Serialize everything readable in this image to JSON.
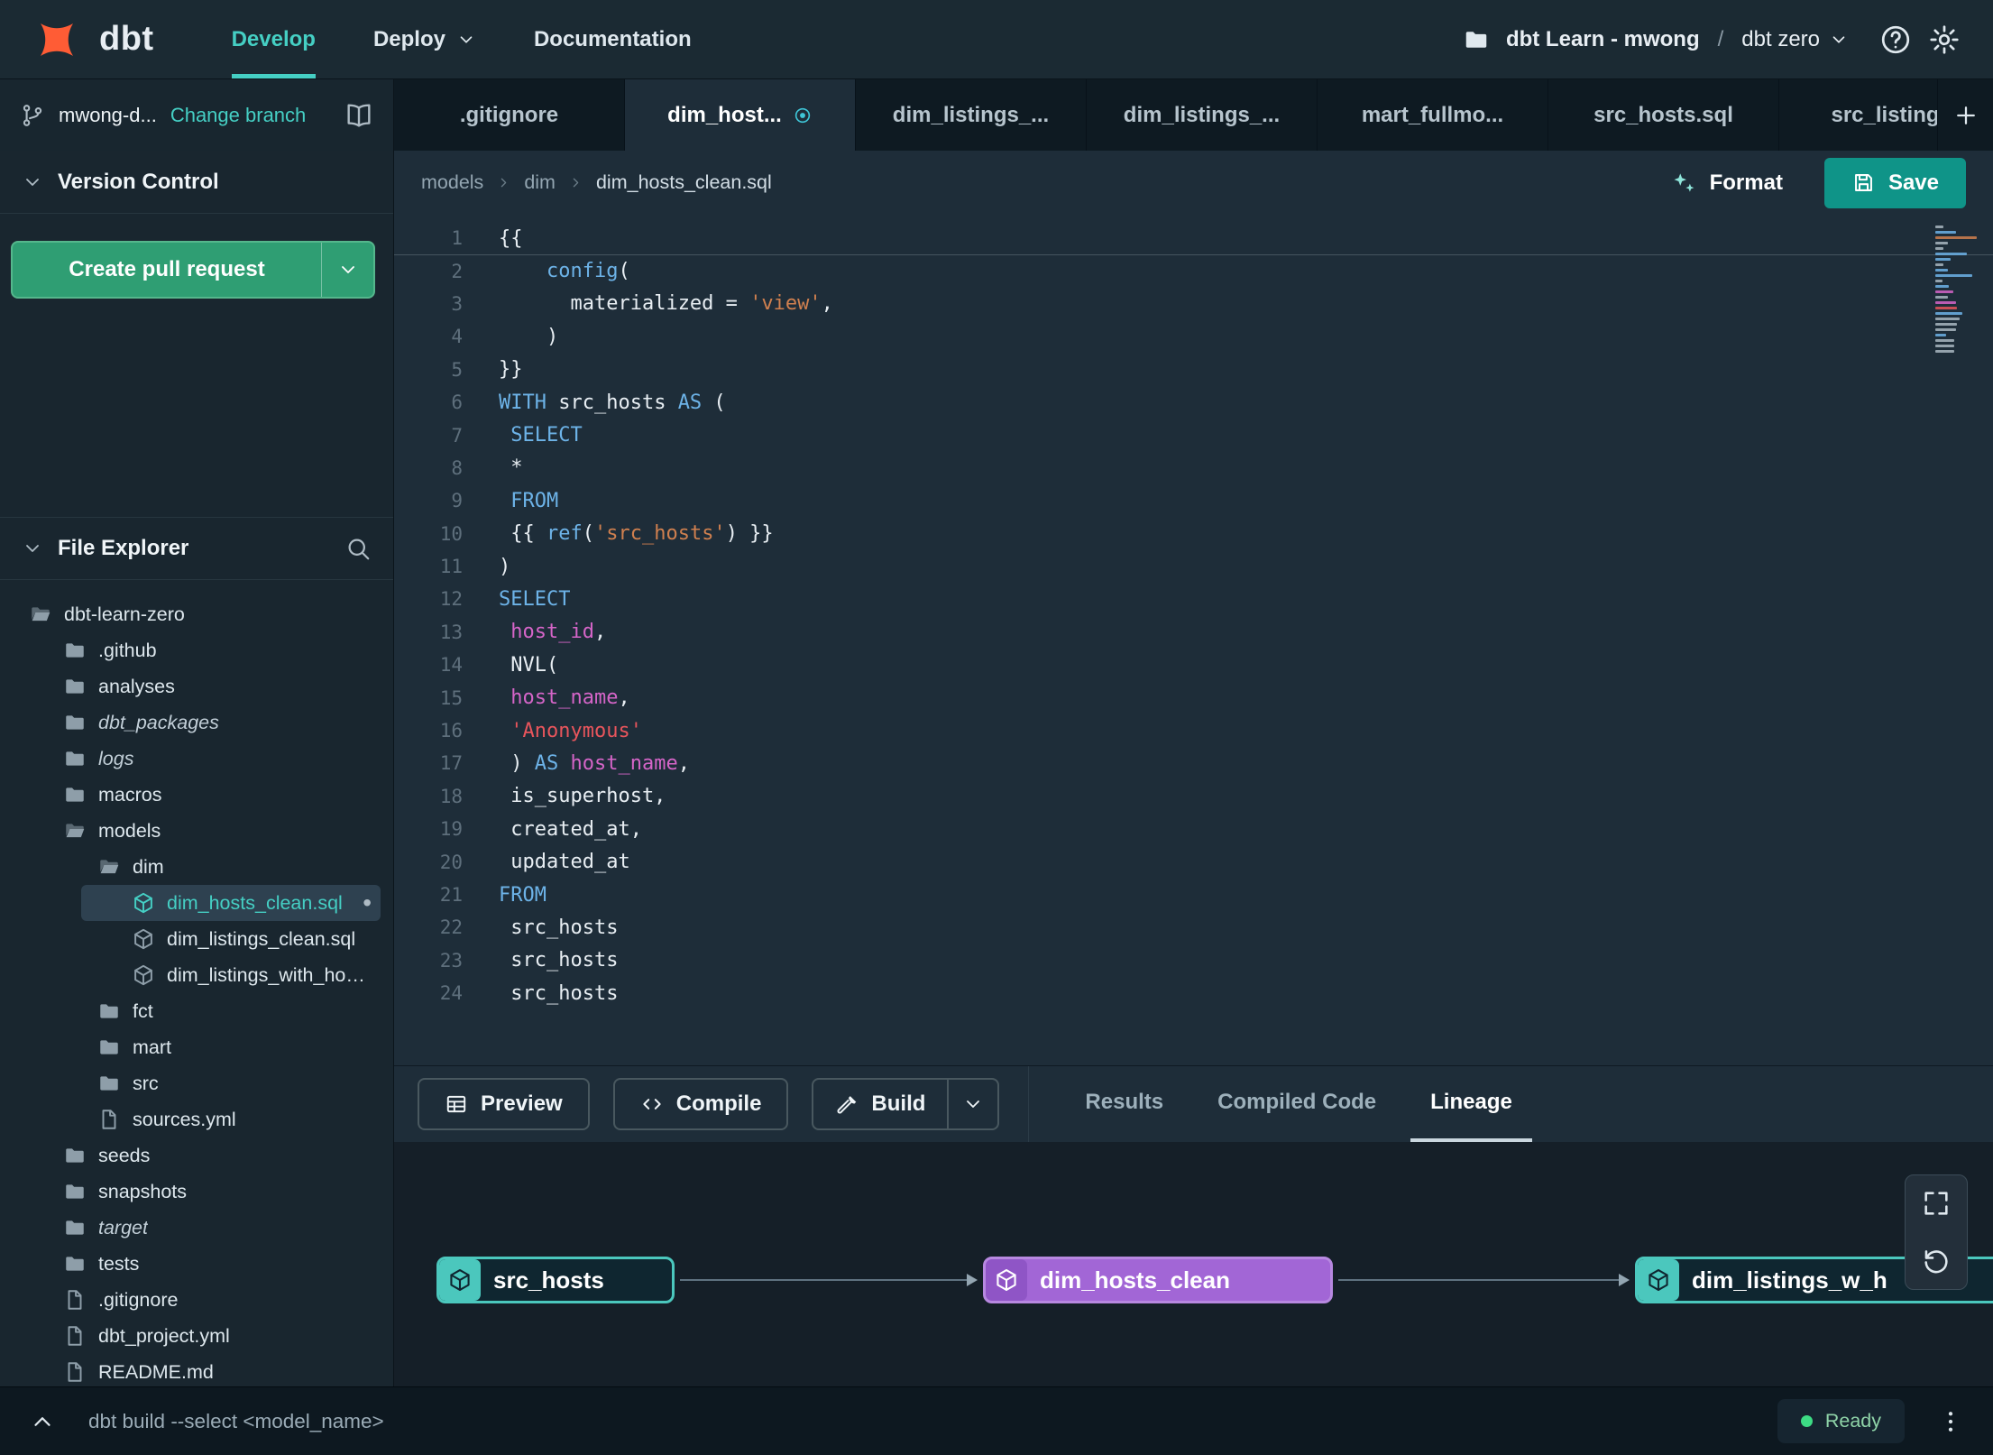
{
  "theme": {
    "accent-teal": "#45cfc4",
    "accent-green": "#2f9e73",
    "save-green": "#0f9488",
    "brand-orange": "#ff5c35",
    "node-teal": "#4bc7bd",
    "node-purple": "#a266d6",
    "code-keyword": "#6db3e8",
    "code-variable": "#d565c8",
    "code-string": "#d0804f",
    "code-string-alt": "#e8555c",
    "status-green": "#3ddc84"
  },
  "navbar": {
    "brand": "dbt",
    "items": [
      {
        "label": "Develop",
        "active": true
      },
      {
        "label": "Deploy",
        "caret": true
      },
      {
        "label": "Documentation"
      }
    ],
    "project": "dbt Learn - mwong",
    "separator": "/",
    "environment": "dbt zero",
    "right_icons": [
      "folder-icon",
      "chevron-down-icon",
      "help-icon",
      "gear-icon"
    ]
  },
  "branch_bar": {
    "branch": "mwong-d...",
    "change_branch": "Change branch",
    "icons": [
      "git-branch-icon",
      "book-icon"
    ]
  },
  "tabs": [
    {
      "label": ".gitignore"
    },
    {
      "label": "dim_host...",
      "active": true,
      "modified": true,
      "modified_icon": "circle-dot"
    },
    {
      "label": "dim_listings_..."
    },
    {
      "label": "dim_listings_..."
    },
    {
      "label": "mart_fullmo..."
    },
    {
      "label": "src_hosts.sql"
    },
    {
      "label": "src_listings."
    }
  ],
  "sidebar": {
    "version_control": {
      "title": "Version Control",
      "create_pr": "Create pull request"
    },
    "file_explorer": {
      "title": "File Explorer",
      "icon": "search-icon"
    },
    "tree": [
      {
        "label": "dbt-learn-zero",
        "type": "folder-open",
        "depth": 0
      },
      {
        "label": ".github",
        "type": "folder",
        "depth": 1
      },
      {
        "label": "analyses",
        "type": "folder",
        "depth": 1
      },
      {
        "label": "dbt_packages",
        "type": "folder",
        "depth": 1,
        "italic": true
      },
      {
        "label": "logs",
        "type": "folder",
        "depth": 1,
        "italic": true
      },
      {
        "label": "macros",
        "type": "folder",
        "depth": 1
      },
      {
        "label": "models",
        "type": "folder-open",
        "depth": 1
      },
      {
        "label": "dim",
        "type": "folder-open",
        "depth": 2
      },
      {
        "label": "dim_hosts_clean.sql",
        "type": "model",
        "depth": 3,
        "selected": true,
        "modified": true
      },
      {
        "label": "dim_listings_clean.sql",
        "type": "model",
        "depth": 3
      },
      {
        "label": "dim_listings_with_hosts...",
        "type": "model",
        "depth": 3
      },
      {
        "label": "fct",
        "type": "folder",
        "depth": 2
      },
      {
        "label": "mart",
        "type": "folder",
        "depth": 2
      },
      {
        "label": "src",
        "type": "folder",
        "depth": 2
      },
      {
        "label": "sources.yml",
        "type": "file",
        "depth": 2
      },
      {
        "label": "seeds",
        "type": "folder",
        "depth": 1
      },
      {
        "label": "snapshots",
        "type": "folder",
        "depth": 1
      },
      {
        "label": "target",
        "type": "folder",
        "depth": 1,
        "italic": true
      },
      {
        "label": "tests",
        "type": "folder",
        "depth": 1
      },
      {
        "label": ".gitignore",
        "type": "file",
        "depth": 1
      },
      {
        "label": "dbt_project.yml",
        "type": "file",
        "depth": 1
      },
      {
        "label": "README.md",
        "type": "file",
        "depth": 1
      }
    ]
  },
  "editor": {
    "breadcrumb": [
      "models",
      "dim",
      "dim_hosts_clean.sql"
    ],
    "format_label": "Format",
    "save_label": "Save",
    "code": [
      [
        [
          "{{",
          "p"
        ]
      ],
      [
        [
          "    ",
          "p"
        ],
        [
          "config",
          "fn"
        ],
        [
          "(",
          "p"
        ]
      ],
      [
        [
          "      ",
          "p"
        ],
        [
          "materialized",
          "p"
        ],
        [
          " = ",
          "p"
        ],
        [
          "'view'",
          "str"
        ],
        [
          ",",
          "p"
        ]
      ],
      [
        [
          "    )",
          "p"
        ]
      ],
      [
        [
          "}}",
          "p"
        ]
      ],
      [
        [
          "WITH",
          "kw"
        ],
        [
          " src_hosts ",
          "p"
        ],
        [
          "AS",
          "kw"
        ],
        [
          " (",
          "p"
        ]
      ],
      [
        [
          " ",
          "p"
        ],
        [
          "SELECT",
          "kw"
        ]
      ],
      [
        [
          " *",
          "p"
        ]
      ],
      [
        [
          " ",
          "p"
        ],
        [
          "FROM",
          "kw"
        ]
      ],
      [
        [
          " {{ ",
          "p"
        ],
        [
          "ref",
          "fn"
        ],
        [
          "(",
          "p"
        ],
        [
          "'src_hosts'",
          "str"
        ],
        [
          ") }}",
          "p"
        ]
      ],
      [
        [
          ")",
          "p"
        ]
      ],
      [
        [
          "SELECT",
          "kw"
        ]
      ],
      [
        [
          " ",
          "p"
        ],
        [
          "host_id",
          "var"
        ],
        [
          ",",
          "p"
        ]
      ],
      [
        [
          " NVL(",
          "p"
        ]
      ],
      [
        [
          " ",
          "p"
        ],
        [
          "host_name",
          "var"
        ],
        [
          ",",
          "p"
        ]
      ],
      [
        [
          " ",
          "p"
        ],
        [
          "'Anonymous'",
          "str2"
        ]
      ],
      [
        [
          " ) ",
          "p"
        ],
        [
          "AS",
          "kw"
        ],
        [
          " ",
          "p"
        ],
        [
          "host_name",
          "var"
        ],
        [
          ",",
          "p"
        ]
      ],
      [
        [
          " is_superhost,",
          "p"
        ]
      ],
      [
        [
          " created_at,",
          "p"
        ]
      ],
      [
        [
          " updated_at",
          "p"
        ]
      ],
      [
        [
          "FROM",
          "kw"
        ]
      ],
      [
        [
          " src_hosts",
          "p"
        ]
      ],
      [
        [
          " src_hosts",
          "p"
        ]
      ],
      [
        [
          " src_hosts",
          "p"
        ]
      ]
    ]
  },
  "bottom": {
    "actions": [
      {
        "label": "Preview",
        "icon": "table"
      },
      {
        "label": "Compile",
        "icon": "code"
      },
      {
        "label": "Build",
        "icon": "hammer",
        "split": true
      }
    ],
    "tabs": [
      {
        "label": "Results"
      },
      {
        "label": "Compiled Code"
      },
      {
        "label": "Lineage",
        "active": true
      }
    ],
    "lineage": {
      "nodes": [
        {
          "label": "src_hosts",
          "kind": "teal"
        },
        {
          "label": "dim_hosts_clean",
          "kind": "purple"
        },
        {
          "label": "dim_listings_w_h",
          "kind": "teal"
        }
      ],
      "controls": [
        "expand-icon",
        "rotate-ccw-icon"
      ]
    }
  },
  "status_bar": {
    "command": "dbt build --select <model_name>",
    "status": "Ready"
  }
}
